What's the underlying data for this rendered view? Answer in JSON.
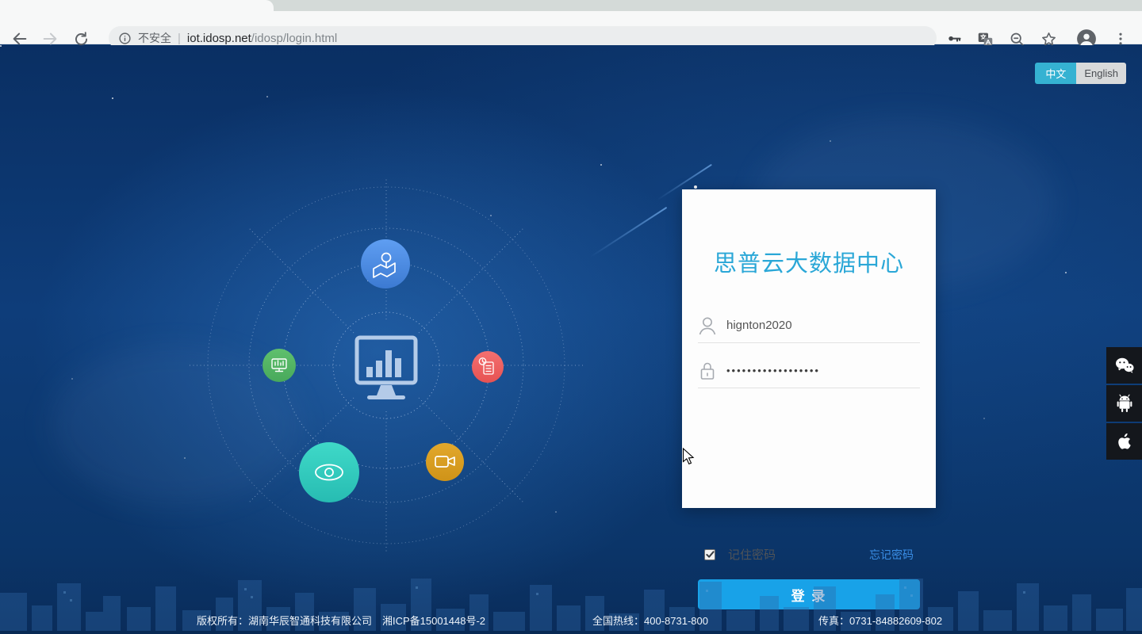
{
  "browser": {
    "security_label": "不安全",
    "url_host": "iot.idosp.net",
    "url_path": "/idosp/login.html"
  },
  "language": {
    "chinese": "中文",
    "english": "English"
  },
  "login": {
    "title": "思普云大数据中心",
    "username_value": "hignton2020",
    "password_masked": "••••••••••••••••••",
    "remember_label": "记住密码",
    "remember_checked": "true",
    "forgot_label": "忘记密码",
    "login_button": "登 录"
  },
  "footer": {
    "copyright": "版权所有：湖南华辰智通科技有限公司　湘ICP备15001448号-2",
    "hotline": "全国热线：400-8731-800",
    "fax": "传真：0731-84882609-802"
  },
  "icons": {
    "toolbar": [
      "back-icon",
      "forward-icon",
      "reload-icon",
      "info-icon",
      "key-icon",
      "translate-icon",
      "zoom-out-icon",
      "star-icon",
      "profile-avatar-icon",
      "menu-dots-icon"
    ],
    "orbit_center": "dashboard-monitor-icon",
    "orbit_satellites": [
      "map-pin-icon",
      "monitor-chart-icon",
      "report-clock-icon",
      "eye-icon",
      "video-camera-icon"
    ],
    "social": [
      "wechat-icon",
      "android-icon",
      "apple-icon"
    ],
    "form": [
      "user-icon",
      "lock-icon"
    ]
  },
  "colors": {
    "background_navy": "#0d3a72",
    "accent_cyan": "#35b2d2",
    "title_blue": "#2aa7d7",
    "button_blue": "#18a2e8",
    "link_blue": "#3a8ee6",
    "satellite_blue": "#4a8ee8",
    "satellite_green": "#54b763",
    "satellite_red": "#ef5e5e",
    "satellite_teal": "#30cfc0",
    "satellite_orange": "#d89c22"
  }
}
